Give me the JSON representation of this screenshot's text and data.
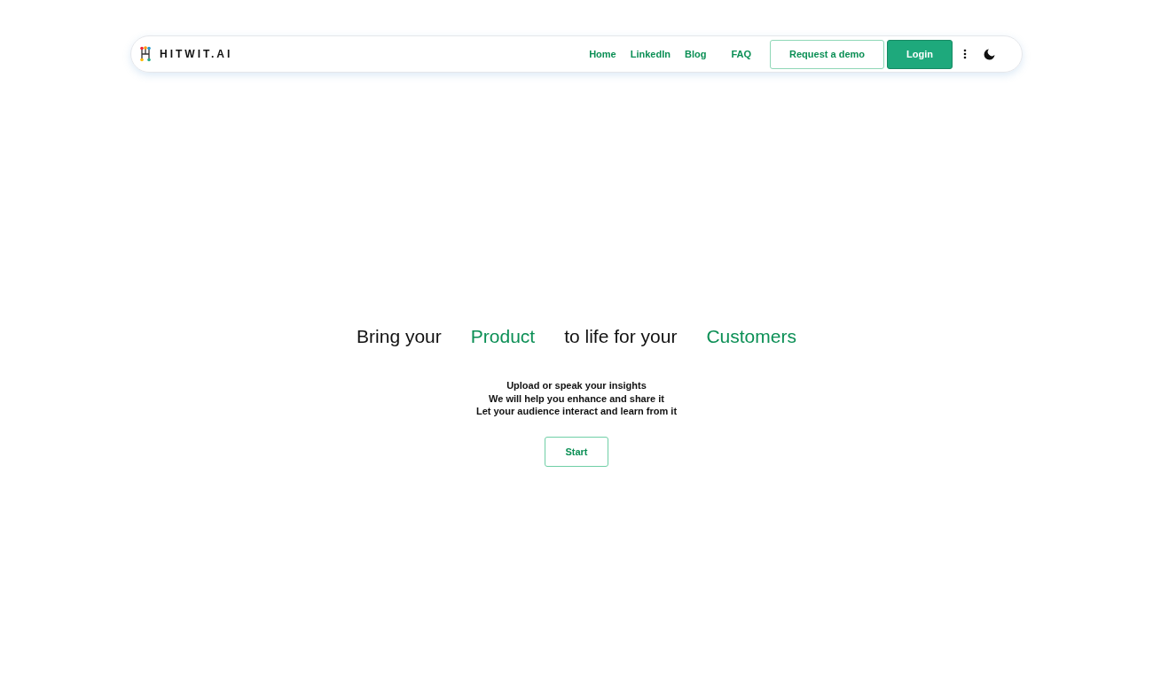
{
  "navbar": {
    "logo": "HITWIT.AI",
    "links": [
      "Home",
      "LinkedIn",
      "Blog",
      "FAQ"
    ],
    "buttons": [
      {
        "label": "Request a demo",
        "kind": "outline"
      },
      {
        "label": "Login",
        "kind": "filled"
      }
    ]
  },
  "hero": {
    "headline": [
      {
        "text": "Bring your",
        "kind": "plain"
      },
      {
        "text": "Product",
        "kind": "highlight"
      },
      {
        "text": "to life for your",
        "kind": "plain"
      },
      {
        "text": "Customers",
        "kind": "highlight"
      }
    ],
    "lines": [
      "Upload or speak your insights",
      "We will help you enhance and share it",
      "Let your audience interact and learn from it"
    ],
    "cta": "Start"
  }
}
